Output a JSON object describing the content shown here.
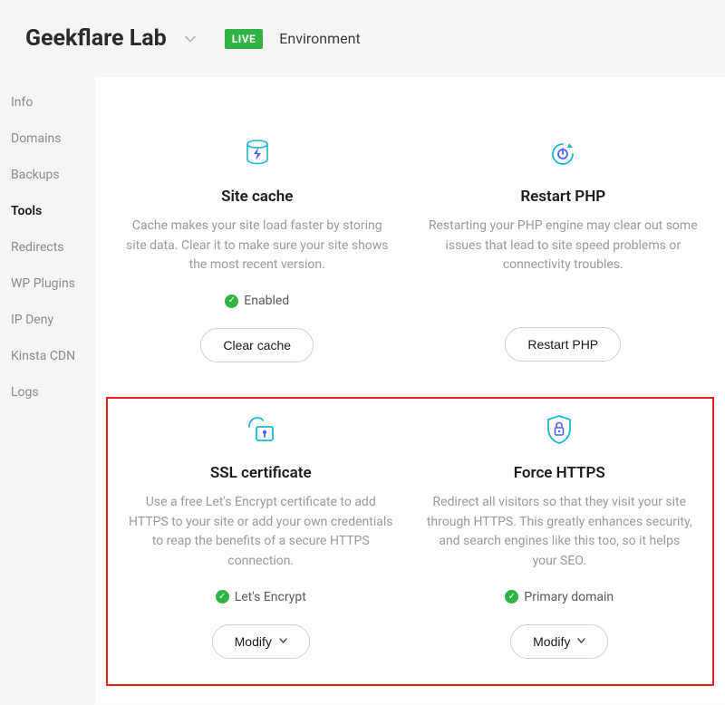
{
  "header": {
    "site_title": "Geekflare Lab",
    "live_badge": "LIVE",
    "env_label": "Environment"
  },
  "sidebar": {
    "items": [
      {
        "label": "Info"
      },
      {
        "label": "Domains"
      },
      {
        "label": "Backups"
      },
      {
        "label": "Tools"
      },
      {
        "label": "Redirects"
      },
      {
        "label": "WP Plugins"
      },
      {
        "label": "IP Deny"
      },
      {
        "label": "Kinsta CDN"
      },
      {
        "label": "Logs"
      }
    ],
    "active_index": 3
  },
  "cards": {
    "site_cache": {
      "title": "Site cache",
      "desc": "Cache makes your site load faster by storing site data. Clear it to make sure your site shows the most recent version.",
      "status": "Enabled",
      "button": "Clear cache"
    },
    "restart_php": {
      "title": "Restart PHP",
      "desc": "Restarting your PHP engine may clear out some issues that lead to site speed problems or connectivity troubles.",
      "button": "Restart PHP"
    },
    "ssl": {
      "title": "SSL certificate",
      "desc": "Use a free Let's Encrypt certificate to add HTTPS to your site or add your own credentials to reap the benefits of a secure HTTPS connection.",
      "status": "Let's Encrypt",
      "button": "Modify"
    },
    "force_https": {
      "title": "Force HTTPS",
      "desc": "Redirect all visitors so that they visit your site through HTTPS. This greatly enhances security, and search engines like this too, so it helps your SEO.",
      "status": "Primary domain",
      "button": "Modify"
    }
  }
}
